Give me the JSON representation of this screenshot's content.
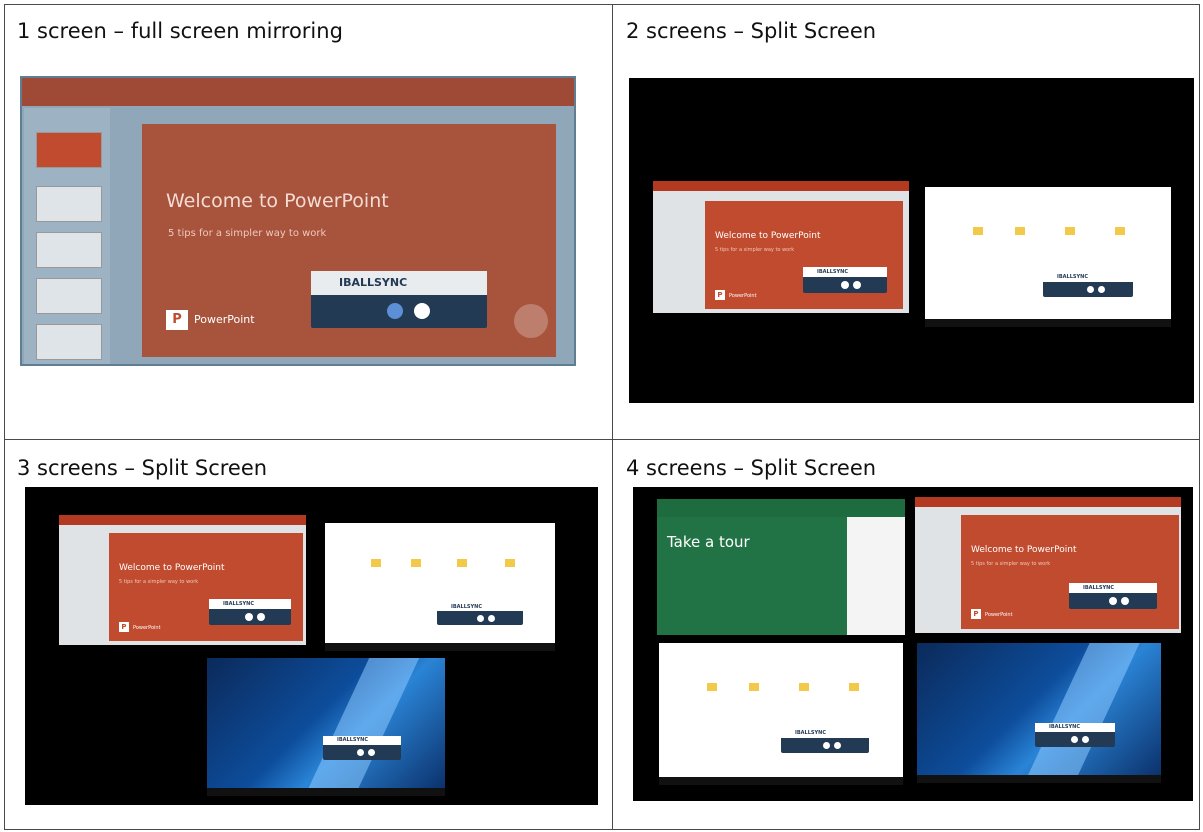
{
  "cells": [
    {
      "title": "1 screen – full screen mirroring"
    },
    {
      "title": "2 screens – Split Screen"
    },
    {
      "title": "3 screens – Split Screen"
    },
    {
      "title": "4 screens – Split Screen"
    }
  ],
  "ppt": {
    "slide_title": "Welcome to PowerPoint",
    "slide_subtitle": "5 tips for a simpler way to work",
    "app_name": "PowerPoint",
    "logo_letter": "P"
  },
  "controller": {
    "brand": "IBALLSYNC"
  },
  "excel": {
    "slide_title": "Take a tour"
  },
  "colors": {
    "ppt_red": "#c14b2e",
    "controller_navy": "#233a55",
    "excel_green": "#217346"
  }
}
